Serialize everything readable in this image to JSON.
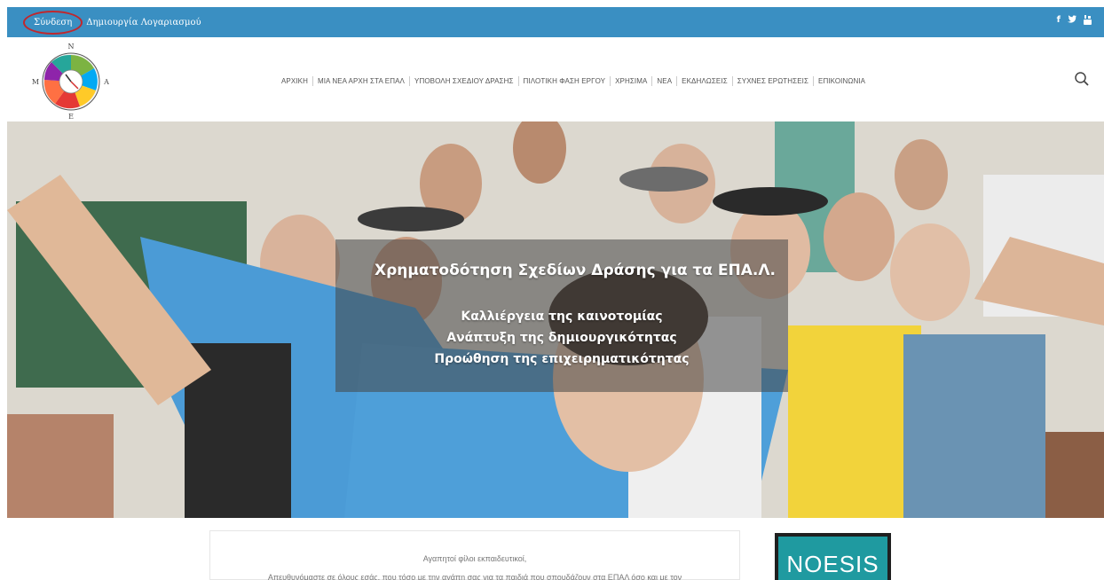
{
  "topbar": {
    "login_label": "Σύνδεση",
    "register_label": "Δημιουργία Λογαριασμού",
    "social_icons": [
      "facebook-icon",
      "twitter-icon",
      "youtube-icon"
    ],
    "social": {
      "facebook": "f",
      "twitter": "🐦",
      "youtube": "▶"
    },
    "bg_color": "#3a8fc2"
  },
  "logo": {
    "north": "Ν",
    "south": "Ε",
    "west": "Μ",
    "east": "Α"
  },
  "nav": {
    "items": [
      "ΑΡΧΙΚΗ",
      "ΜΙΑ ΝΕΑ ΑΡΧΗ ΣΤΑ ΕΠΑΛ",
      "ΥΠΟΒΟΛΗ ΣΧΕΔΙΟΥ ΔΡΑΣΗΣ",
      "ΠΙΛΟΤΙΚΗ ΦΑΣΗ ΕΡΓΟΥ",
      "ΧΡΗΣΙΜΑ",
      "ΝΕΑ",
      "ΕΚΔΗΛΩΣΕΙΣ",
      "ΣΥΧΝΕΣ ΕΡΩΤΗΣΕΙΣ",
      "ΕΠΙΚΟΙΝΩΝΙΑ"
    ]
  },
  "hero": {
    "title": "Χρηματοδότηση Σχεδίων Δράσης για τα ΕΠΑ.Λ.",
    "lines": [
      "Καλλιέργεια της καινοτομίας",
      "Ανάπτυξη της δημιουργικότητας",
      "Προώθηση της επιχειρηματικότητας"
    ]
  },
  "welcome": {
    "greeting": "Αγαπητοί φίλοι εκπαιδευτικοί,",
    "intro": "Απευθυνόμαστε σε όλους εσάς, που τόσο με την αγάπη σας για τα παιδιά που σπουδάζουν στα ΕΠΑΛ όσο και με τον"
  },
  "sponsor": {
    "name": "NOESIS",
    "color": "#1f9aa0"
  }
}
